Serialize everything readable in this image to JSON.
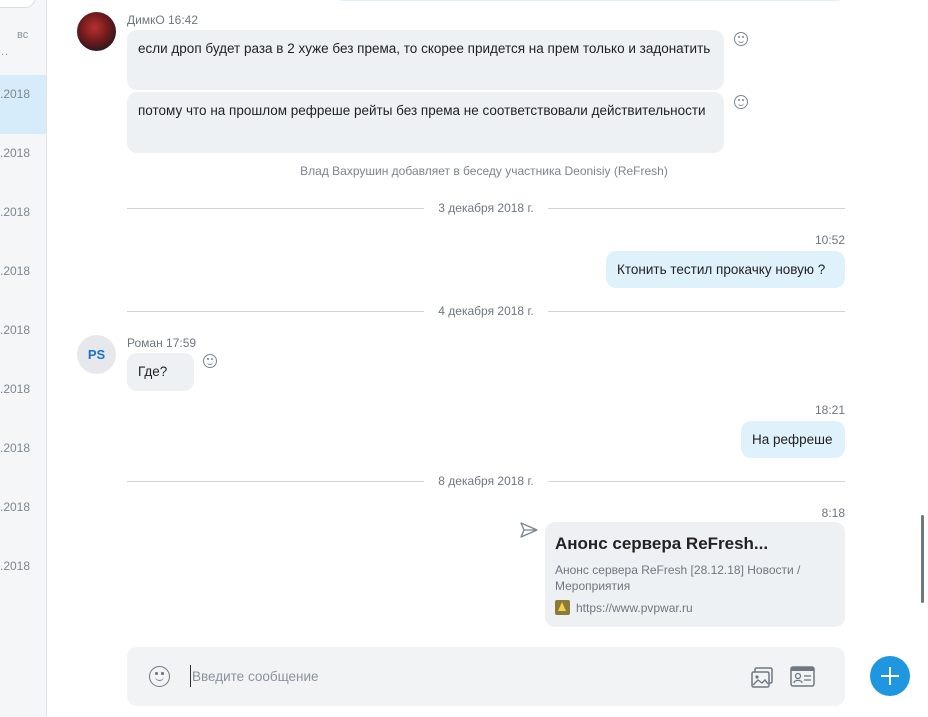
{
  "sidebar": {
    "day_label": "вс",
    "items": [
      {
        "date": ".2018"
      },
      {
        "date": ".2018"
      },
      {
        "date": ".2018"
      },
      {
        "date": ".2018"
      },
      {
        "date": ".2018"
      },
      {
        "date": ".2018"
      },
      {
        "date": ".2018"
      },
      {
        "date": ".2018"
      },
      {
        "date": ".2018"
      }
    ]
  },
  "messages": {
    "m1": {
      "sender": "ДимкО 16:42",
      "text1": "если дроп будет раза в 2 хуже без према, то скорее придется на прем только и задонатить",
      "text2": "потому что на прошлом рефреше рейты без према не соответствовали действительности"
    },
    "system": "Влад Вахрушин добавляет в беседу участника Deonisiy (ReFresh)",
    "divider1": "3 декабря 2018 г.",
    "out1": {
      "time": "10:52",
      "text": "Ктонить тестил прокачку новую ?"
    },
    "divider2": "4 декабря 2018 г.",
    "m2": {
      "avatar_initials": "PS",
      "sender": "Роман 17:59",
      "text": "Где?"
    },
    "out2": {
      "time": "18:21",
      "text": "На рефреше"
    },
    "divider3": "8 декабря 2018 г.",
    "out3": {
      "time": "8:18",
      "card_title": "Анонс сервера ReFresh...",
      "card_desc": "Анонс сервера ReFresh [28.12.18] Новости / Мероприятия",
      "card_url": "https://www.pvpwar.ru"
    }
  },
  "composer": {
    "placeholder": "Введите сообщение"
  },
  "icons": {
    "emoji": "emoji-icon",
    "media": "media-icon",
    "contact": "contact-card-icon",
    "send": "send-icon",
    "add": "add-icon"
  },
  "colors": {
    "accent": "#1e96e0",
    "outgoing_bubble": "#dff1fb",
    "incoming_bubble": "#eef1f4"
  }
}
